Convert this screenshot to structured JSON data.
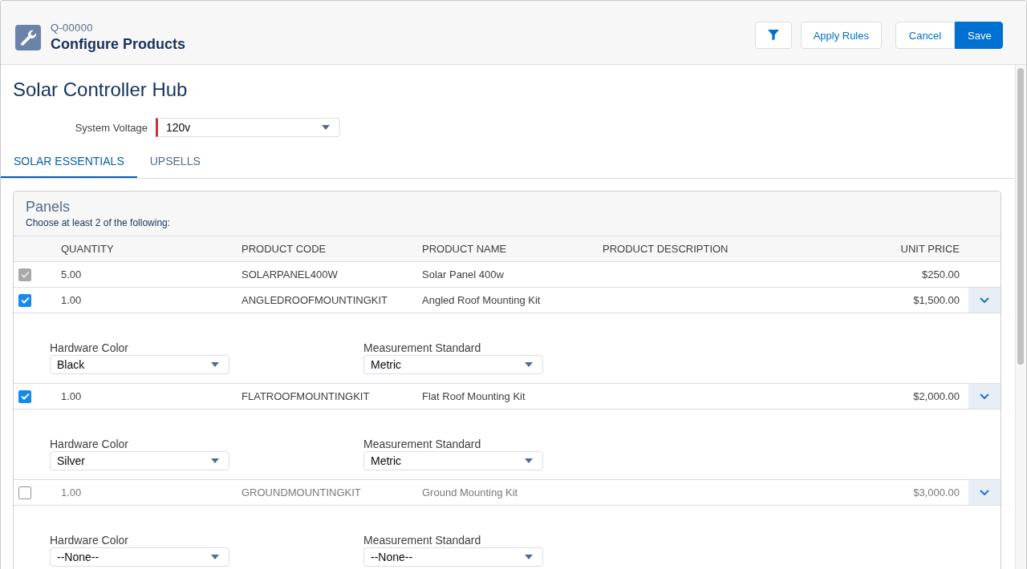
{
  "header": {
    "record_number": "Q-00000",
    "title": "Configure Products",
    "buttons": [
      {
        "label": "Apply Rules",
        "kind": "neutral"
      }
    ],
    "button_group": [
      {
        "label": "Cancel",
        "kind": "neutral"
      },
      {
        "label": "Save",
        "kind": "brand"
      }
    ]
  },
  "product": {
    "title": "Solar Controller Hub",
    "fields": [
      {
        "label": "System Voltage",
        "value": "120v",
        "required": true
      }
    ]
  },
  "tabs": [
    {
      "label": "SOLAR ESSENTIALS",
      "selected": true
    },
    {
      "label": "UPSELLS",
      "selected": false
    }
  ],
  "feature": {
    "title": "Panels",
    "instructions": "Choose at least 2 of the following:",
    "columns": [
      "QUANTITY",
      "PRODUCT CODE",
      "PRODUCT NAME",
      "PRODUCT DESCRIPTION",
      "UNIT PRICE"
    ],
    "rows": [
      {
        "checked": true,
        "disabled": true,
        "quantity": "5.00",
        "product_code": "SOLARPANEL400W",
        "product_name": "Solar Panel 400w",
        "unit_price": "$250.00"
      },
      {
        "checked": true,
        "disabled": false,
        "quantity": "1.00",
        "product_code": "ANGLEDROOFMOUNTINGKIT",
        "product_name": "Angled Roof Mounting Kit",
        "unit_price": "$1,500.00",
        "options": [
          {
            "label": "Hardware Color",
            "value": "Black"
          },
          {
            "label": "Measurement Standard",
            "value": "Metric"
          }
        ]
      },
      {
        "checked": true,
        "disabled": false,
        "quantity": "1.00",
        "product_code": "FLATROOFMOUNTINGKIT",
        "product_name": "Flat Roof Mounting Kit",
        "unit_price": "$2,000.00",
        "options": [
          {
            "label": "Hardware Color",
            "value": "Silver"
          },
          {
            "label": "Measurement Standard",
            "value": "Metric"
          }
        ]
      },
      {
        "checked": false,
        "disabled": false,
        "quantity": "1.00",
        "product_code": "GROUNDMOUNTINGKIT",
        "product_name": "Ground Mounting Kit",
        "unit_price": "$3,000.00",
        "options": [
          {
            "label": "Hardware Color",
            "value": "--None--"
          },
          {
            "label": "Measurement Standard",
            "value": "--None--"
          }
        ]
      }
    ]
  }
}
